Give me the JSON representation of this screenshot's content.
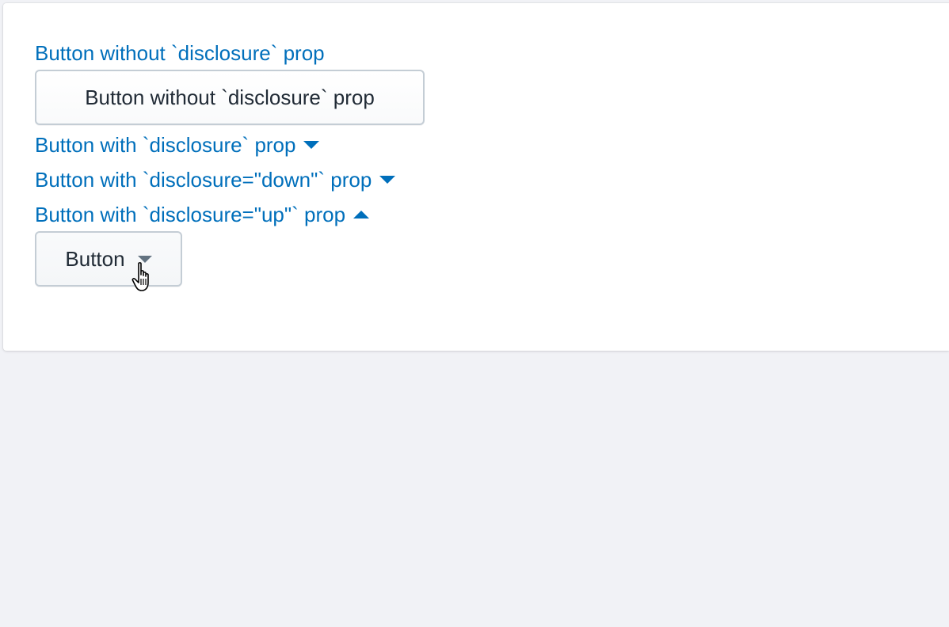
{
  "links": {
    "no_disclosure": "Button without `disclosure` prop",
    "with_disclosure": "Button with `disclosure` prop",
    "disclosure_down": "Button with `disclosure=\"down\"` prop",
    "disclosure_up": "Button with `disclosure=\"up\"` prop"
  },
  "buttons": {
    "no_disclosure": "Button without `disclosure` prop",
    "disclosure": "Button"
  },
  "icons": {
    "disclosure_down": "caret-down-icon",
    "disclosure_up": "caret-up-icon",
    "cursor": "hand-pointer-icon"
  },
  "colors": {
    "link": "#006fbb",
    "text": "#212b36",
    "background": "#f1f2f6",
    "card": "#ffffff"
  }
}
